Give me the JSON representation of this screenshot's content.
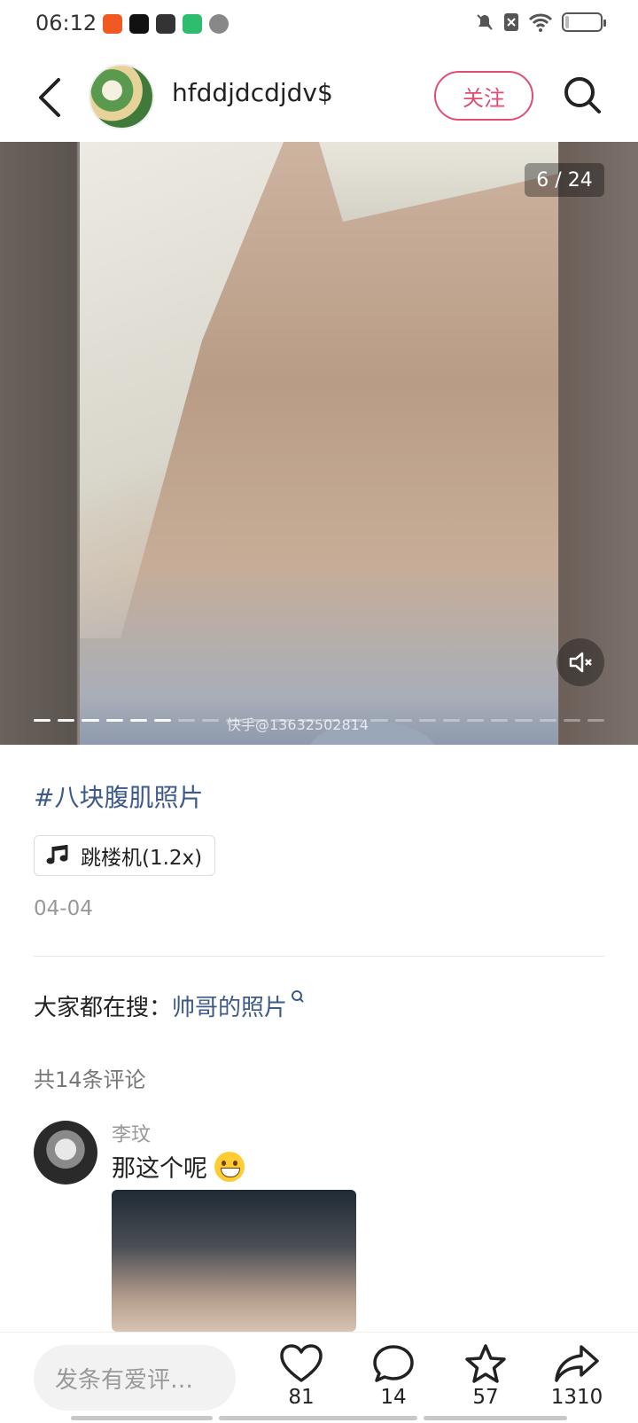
{
  "status_bar": {
    "time": "06:12",
    "app_icons": [
      {
        "name": "taobao-app-icon",
        "color": "#f05a22"
      },
      {
        "name": "douyin-app-icon",
        "color": "#111111"
      },
      {
        "name": "app-icon-3",
        "color": "#333333"
      },
      {
        "name": "iqiyi-app-icon",
        "color": "#2dbd6e"
      },
      {
        "name": "app-icon-5",
        "color": "#777777"
      }
    ],
    "battery_level": 0.08
  },
  "header": {
    "username": "hfddjdcdjdv$",
    "follow_label": "关注"
  },
  "media": {
    "page_counter": "6 / 24",
    "watermark": "快手@13632502814",
    "total_images": 24,
    "current_index": 6
  },
  "post": {
    "hashtag": "#八块腹肌照片",
    "music": "跳楼机(1.2x)",
    "date": "04-04"
  },
  "trending": {
    "prefix": "大家都在搜：",
    "query": "帅哥的照片"
  },
  "comments": {
    "count_label": "共14条评论",
    "items": [
      {
        "author": "李玟",
        "text": "那这个呢"
      }
    ]
  },
  "bottom_bar": {
    "input_placeholder": "发条有爱评…",
    "likes": "81",
    "comments": "14",
    "favorites": "57",
    "shares": "1310"
  },
  "colors": {
    "accent": "#e04c73",
    "link": "#3d5a8a"
  }
}
